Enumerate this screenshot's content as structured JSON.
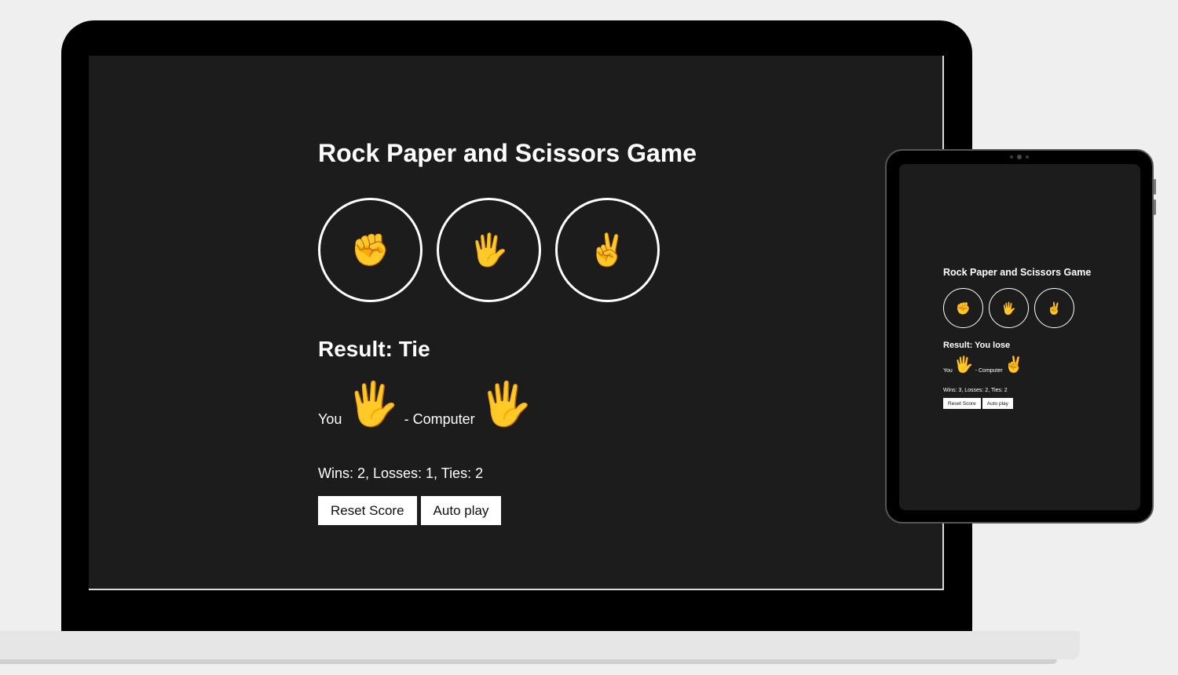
{
  "game": {
    "title": "Rock Paper and Scissors Game",
    "moves": [
      {
        "name": "rock",
        "emoji": "✊"
      },
      {
        "name": "paper",
        "emoji": "🖐️"
      },
      {
        "name": "scissors",
        "emoji": "✌️"
      }
    ],
    "result_label": "Result:",
    "result_value": "Tie",
    "you_label": "You",
    "player_move": "🖐️",
    "computer_label": "- Computer",
    "computer_move": "🖐️",
    "score_text": "Wins: 2, Losses: 1, Ties: 2",
    "reset_label": "Reset Score",
    "autoplay_label": "Auto play"
  },
  "tablet_game": {
    "title": "Rock Paper and Scissors Game",
    "moves": [
      {
        "name": "rock",
        "emoji": "✊"
      },
      {
        "name": "paper",
        "emoji": "🖐️"
      },
      {
        "name": "scissors",
        "emoji": "✌️"
      }
    ],
    "result_label": "Result:",
    "result_value": "You lose",
    "you_label": "You",
    "player_move": "🖐️",
    "computer_label": "- Computer",
    "computer_move": "✌️",
    "score_text": "Wins: 3, Losses: 2, Ties: 2",
    "reset_label": "Reset Score",
    "autoplay_label": "Auto play"
  },
  "colors": {
    "screen_bg": "#1c1c1c",
    "text": "#ffffff",
    "emoji_tone": "#f4b820"
  }
}
